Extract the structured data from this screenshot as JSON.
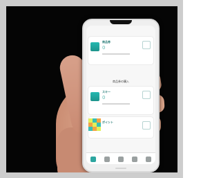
{
  "scene": {
    "colors": {
      "background": "#050505",
      "border": "#cdcdcd",
      "accent": "#25b8b0",
      "phone_body": "#efefef"
    }
  },
  "app": {
    "cards": [
      {
        "title": "商品券",
        "value": "0"
      },
      {
        "title": "スキー",
        "value": "0"
      },
      {
        "title": "ポイント",
        "value": ""
      }
    ],
    "center_text": "商品券の購入",
    "tabs": [
      "home-icon",
      "menu-icon",
      "card-icon",
      "user-icon",
      "settings-icon"
    ]
  }
}
